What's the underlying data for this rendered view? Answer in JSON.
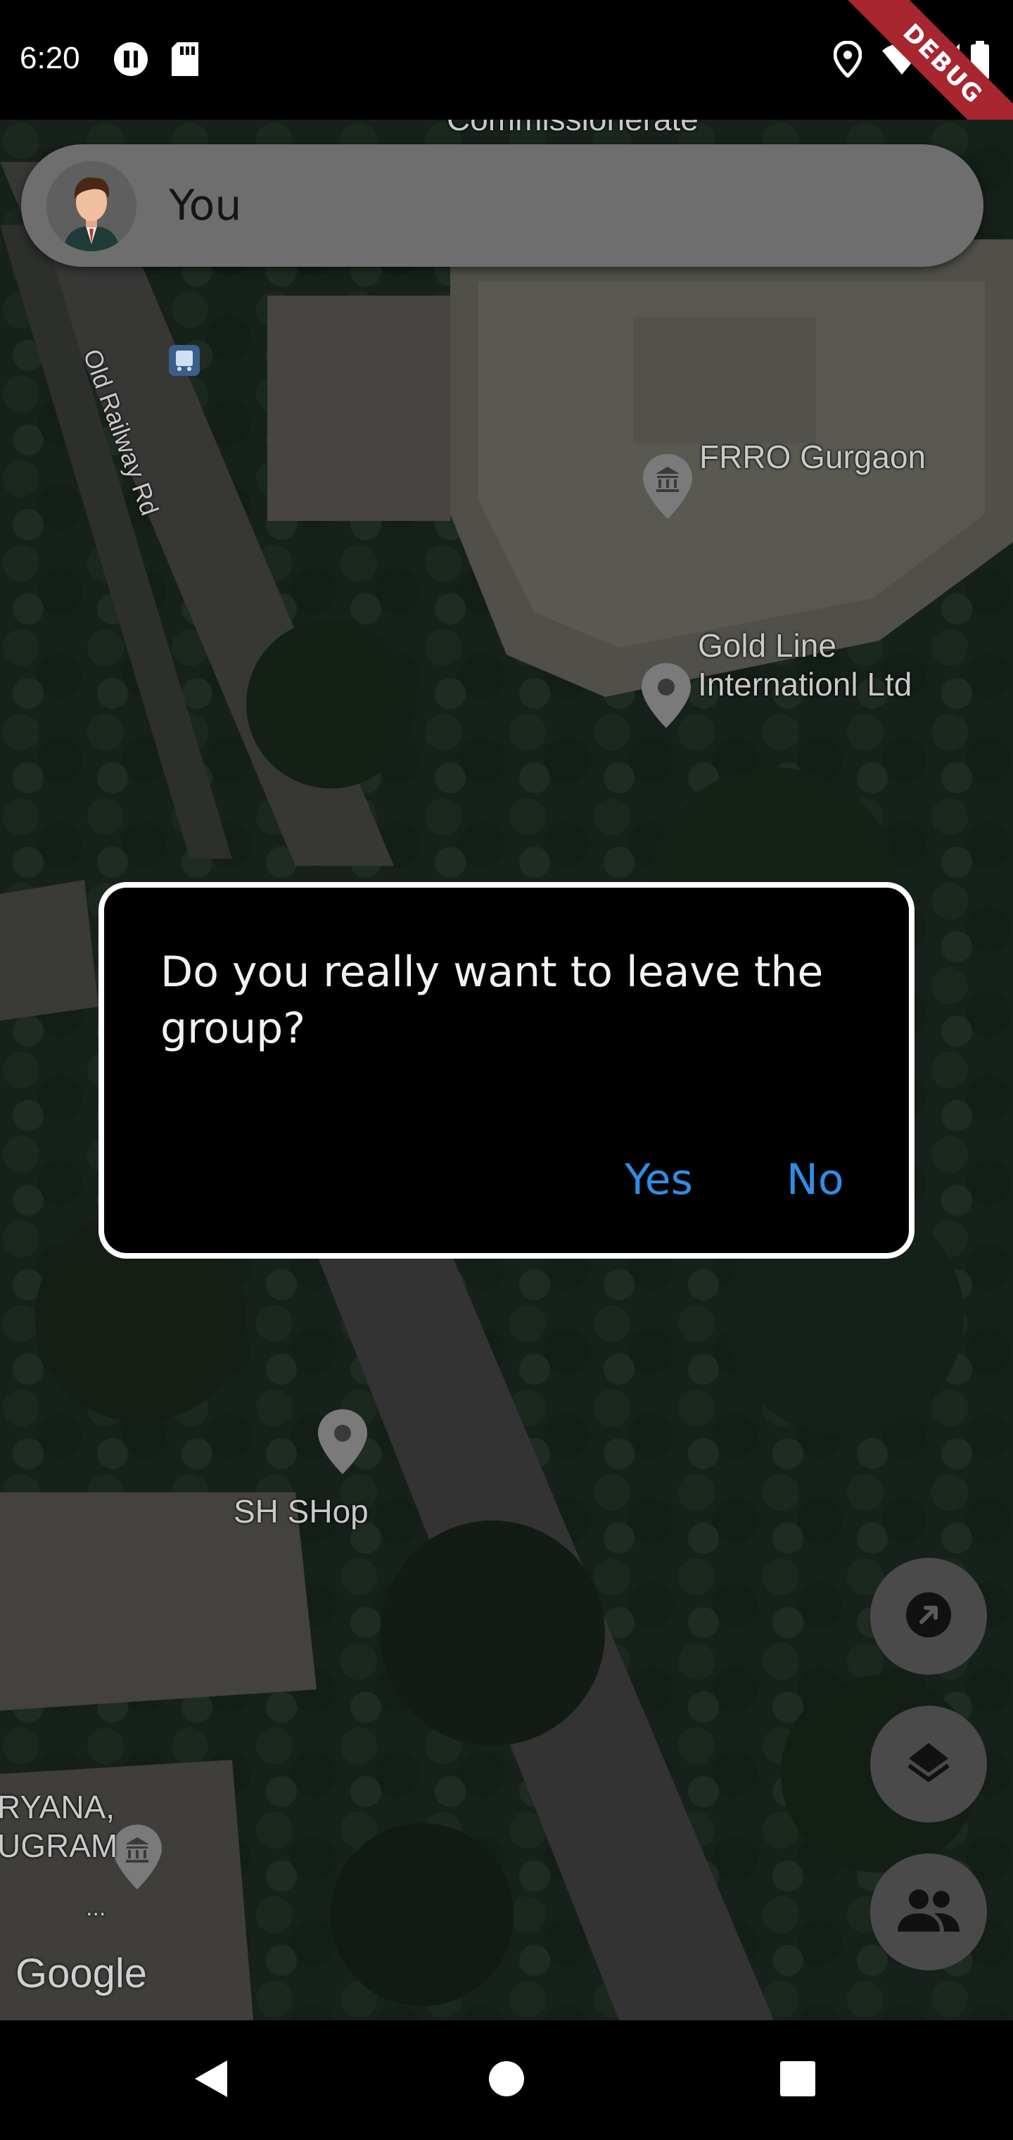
{
  "status_bar": {
    "time": "6:20",
    "icons": [
      "incognito-icon",
      "sd-card-icon",
      "location-icon",
      "wifi-icon",
      "signal-icon",
      "battery-icon"
    ],
    "debug_banner": "DEBUG"
  },
  "map": {
    "labels": {
      "commissionerate": "Commissionerate",
      "old_railway_rd": "Old Railway Rd",
      "frro": "FRRO Gurgaon",
      "gold_line": "Gold Line\nInternationl Ltd",
      "sh_shop": "SH SHop",
      "haryana": "RYANA,\nUGRAM",
      "ellipsis": "...",
      "google": "Google"
    }
  },
  "user_bar": {
    "name": "You"
  },
  "dialog": {
    "message": "Do you really want to leave the group?",
    "yes_label": "Yes",
    "no_label": "No",
    "button_color": "#2f8ee6"
  },
  "fabs": {
    "icons": [
      "navigation-arrow-icon",
      "layers-icon",
      "people-icon"
    ]
  },
  "nav_bar": {
    "icons": [
      "back-icon",
      "home-icon",
      "recents-icon"
    ]
  }
}
